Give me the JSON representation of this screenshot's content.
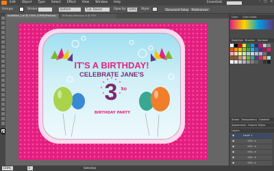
{
  "menu": {
    "items": [
      "Edit",
      "Object",
      "Type",
      "Select",
      "Effect",
      "View",
      "Window",
      "Help"
    ],
    "workspace": "Essentials",
    "search_placeholder": ""
  },
  "control": {
    "object_label": "Groups",
    "stroke_label": "Stroke:",
    "stroke_value": "",
    "brush_value": "Uniform",
    "point_value": "5 pt. Round",
    "opacity_label": "Opacity:",
    "opacity_value": "100%",
    "style_label": "Style:",
    "document_setup": "Document Setup",
    "preferences": "Preferences"
  },
  "tabs": [
    {
      "label": "Invitation_1.ai @ 150% (CMYK/Preview)",
      "active": true
    },
    {
      "label": "Birthday Backups.ai @ 33% (CMYK/Preview)",
      "active": false
    }
  ],
  "invitation": {
    "line1": "IT'S A BIRTHDAY!",
    "line2": "CELEBRATE JANE'S",
    "age": "3",
    "suffix": "RD",
    "line3": "BIRTHDAY PARTY"
  },
  "panels": {
    "color_tabs": [
      "Color",
      "Color Guide"
    ],
    "swatch_tabs": [
      "Swatches",
      "Brushes",
      "Symbols"
    ],
    "stroke_tabs": [
      "Stroke",
      "Transparency",
      "Gradient"
    ],
    "appearance_tabs": [
      "Appearance",
      "Graphic Styles"
    ],
    "layers_title": "Layers",
    "layer_name": "Layer 1",
    "sublayers": [
      "<Gr...>",
      "<Gr...>",
      "<Gr...>",
      "<Gr...>",
      "<Gr...>"
    ]
  },
  "status": {
    "zoom": "150%",
    "page": "1",
    "tool": "Selection"
  },
  "colors": {
    "card_pink": "#e21e7f",
    "title_pink": "#e0277f",
    "title_plum": "#7a2a6f"
  }
}
